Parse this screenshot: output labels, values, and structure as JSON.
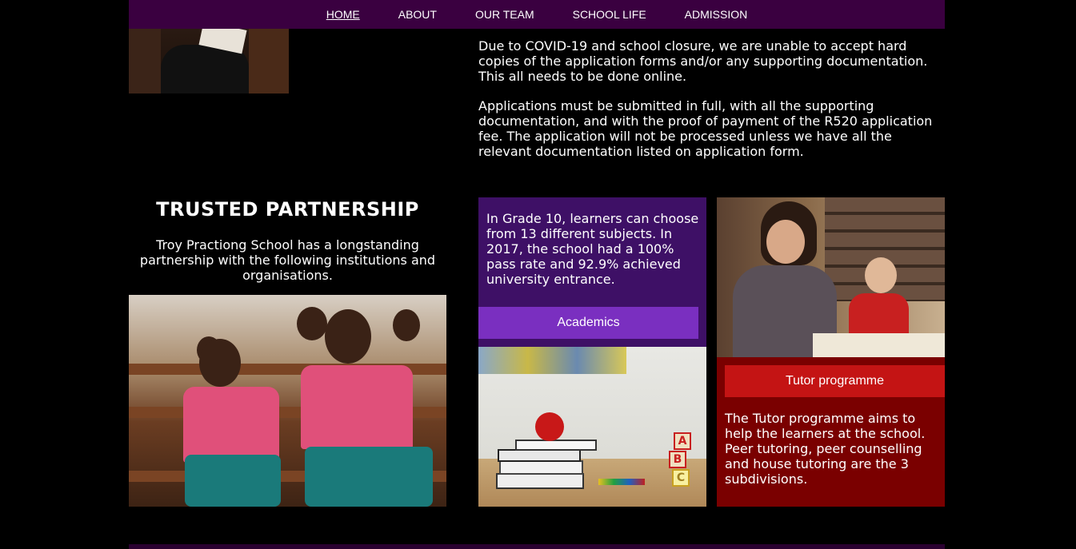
{
  "nav": {
    "items": [
      {
        "label": "HOME",
        "active": true
      },
      {
        "label": "ABOUT",
        "active": false
      },
      {
        "label": "OUR TEAM",
        "active": false
      },
      {
        "label": "SCHOOL LIFE",
        "active": false
      },
      {
        "label": "ADMISSION",
        "active": false
      }
    ]
  },
  "intro": {
    "paragraph1": "Due to COVID-19 and school closure, we are unable to accept hard copies of the application forms and/or any supporting documentation. This all needs to be done online.",
    "paragraph2": "Applications must be submitted in full, with all the supporting documentation, and with the proof of payment of the R520 application fee. The application will not be processed unless we have all the relevant documentation listed on application form."
  },
  "partnership": {
    "title": "TRUSTED PARTNERSHIP",
    "text": "Troy Practiong School has a longstanding partnership with the following institutions and organisations."
  },
  "academics": {
    "text": "In Grade 10, learners can choose from 13 different subjects. In 2017, the school had a 100% pass rate and 92.9% achieved university entrance.",
    "button_label": "Academics"
  },
  "tutor": {
    "button_label": "Tutor programme",
    "text": "The Tutor programme aims to help the learners at the school. Peer tutoring, peer counselling and house tutoring are the 3 subdivisions."
  },
  "colors": {
    "nav_bg": "#3a0040",
    "academics_bg": "#3e1066",
    "academics_button": "#7a2fc0",
    "tutor_bg": "#7a0000",
    "tutor_button": "#c41414"
  },
  "images": {
    "block_letters": [
      "A",
      "B",
      "C"
    ]
  }
}
